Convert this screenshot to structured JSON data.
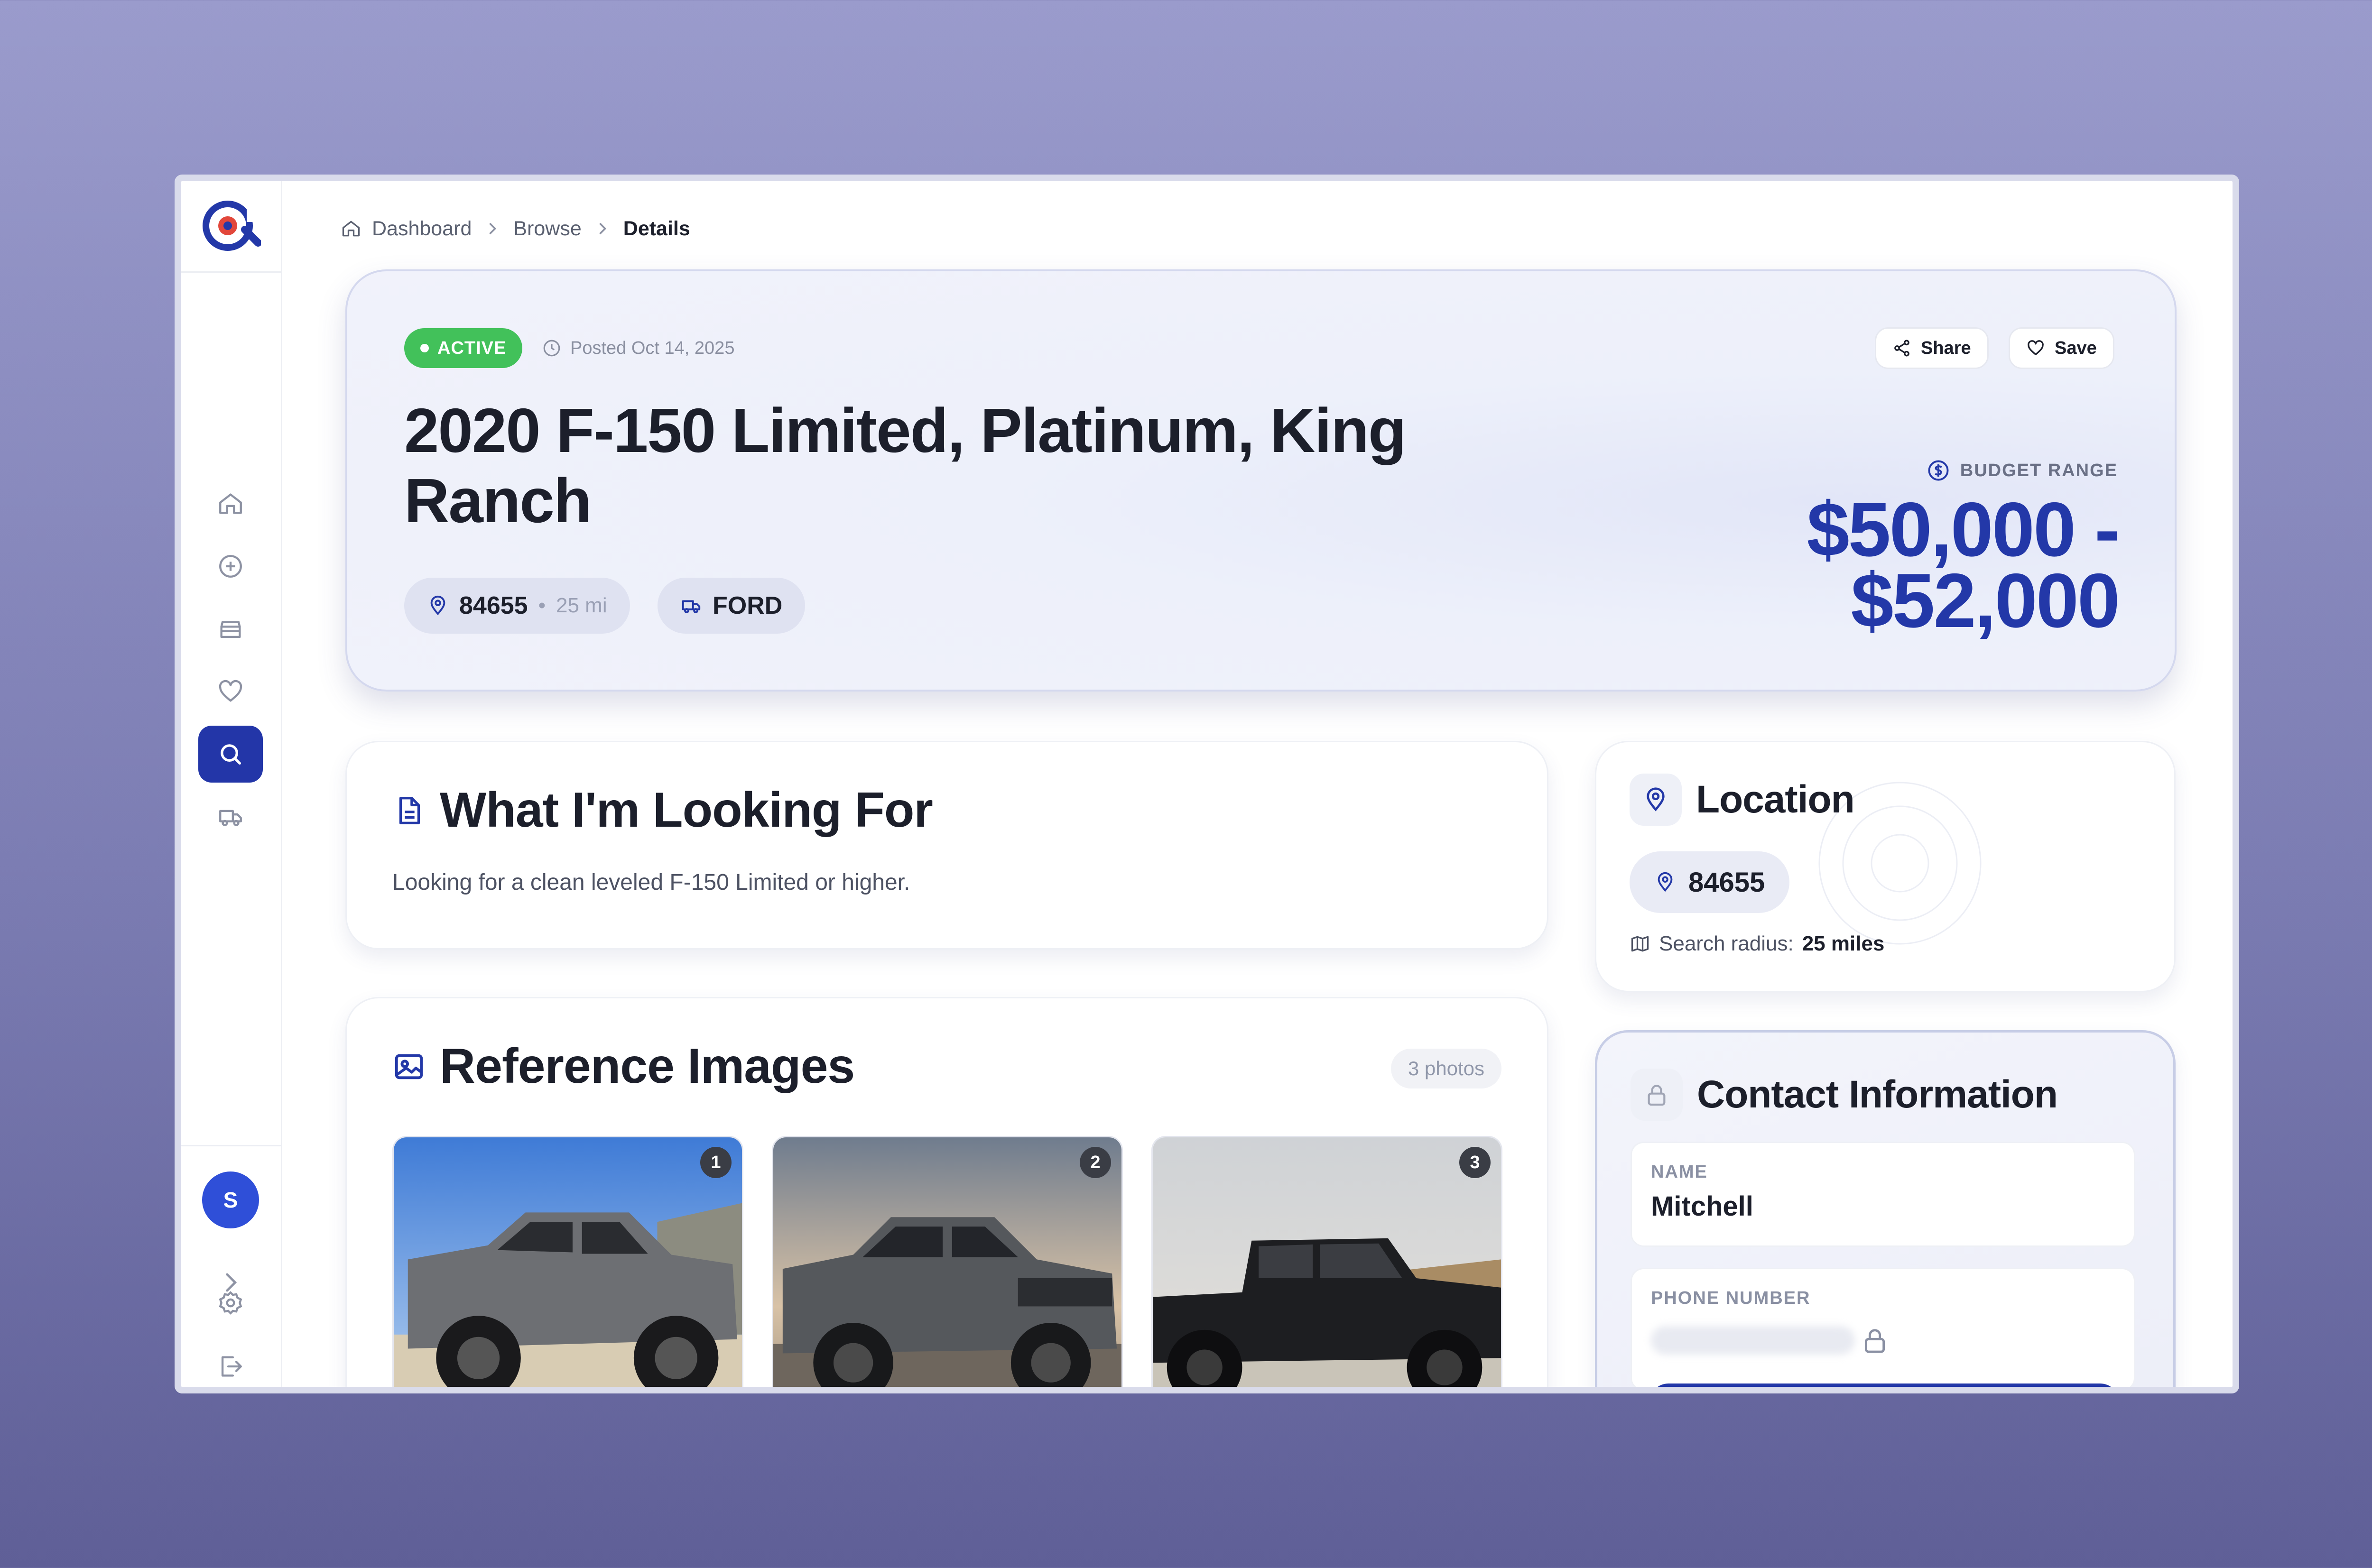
{
  "breadcrumb": {
    "items": [
      "Dashboard",
      "Browse",
      "Details"
    ]
  },
  "hero": {
    "status": "ACTIVE",
    "posted": "Posted Oct 14, 2025",
    "title": "2020 F-150 Limited, Platinum, King Ranch",
    "zip": "84655",
    "distance": "25 mi",
    "make": "FORD",
    "share_label": "Share",
    "save_label": "Save",
    "budget_label": "BUDGET RANGE",
    "budget_value": "$50,000 - $52,000"
  },
  "looking_for": {
    "title": "What I'm Looking For",
    "text": "Looking for a clean leveled F-150 Limited or higher."
  },
  "reference_images": {
    "title": "Reference Images",
    "count": "3 photos",
    "photos": [
      {
        "number": "1",
        "color": "#6d6f73"
      },
      {
        "number": "2",
        "color": "#55585c"
      },
      {
        "number": "3",
        "color": "#1d1e21"
      }
    ]
  },
  "location": {
    "title": "Location",
    "zip": "84655",
    "radius_label": "Search radius:",
    "radius_value": "25 miles"
  },
  "contact": {
    "title": "Contact Information",
    "name_label": "NAME",
    "name_value": "Mitchell",
    "phone_label": "PHONE NUMBER"
  },
  "user": {
    "initial": "S"
  },
  "colors": {
    "accent": "#2338a8",
    "active": "#42c15a"
  }
}
